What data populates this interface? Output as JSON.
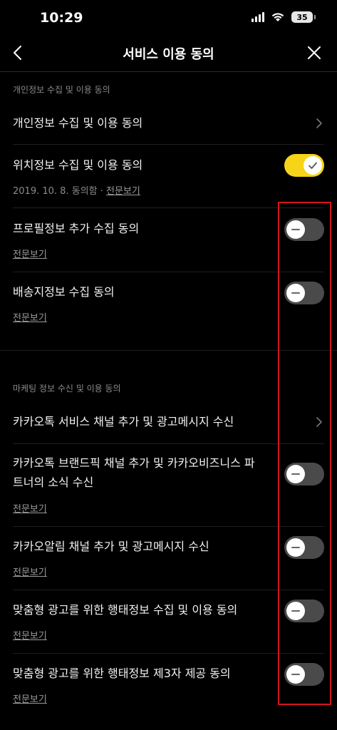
{
  "status_bar": {
    "time": "10:29",
    "battery": "35"
  },
  "header": {
    "title": "서비스 이용 동의"
  },
  "sections": [
    {
      "title": "개인정보 수집 및 이용 동의",
      "items": [
        {
          "title": "개인정보 수집 및 이용 동의",
          "control": "chevron"
        },
        {
          "title": "위치정보 수집 및 이용 동의",
          "date": "2019. 10. 8. 동의함",
          "separator": "·",
          "link": "전문보기",
          "control": "toggle",
          "state": "on"
        },
        {
          "title": "프로필정보 추가 수집 동의",
          "link": "전문보기",
          "control": "toggle",
          "state": "off"
        },
        {
          "title": "배송지정보 수집 동의",
          "link": "전문보기",
          "control": "toggle",
          "state": "off"
        }
      ]
    },
    {
      "title": "마케팅 정보 수신 및 이용 동의",
      "items": [
        {
          "title": "카카오톡 서비스 채널 추가 및 광고메시지 수신",
          "control": "chevron"
        },
        {
          "title_line1": "카카오톡 브랜드픽 채널 추가 및 카카오비즈니스 파",
          "title_line2": "트너의 소식 수신",
          "link": "전문보기",
          "control": "toggle",
          "state": "off"
        },
        {
          "title": "카카오알림 채널 추가 및 광고메시지 수신",
          "link": "전문보기",
          "control": "toggle",
          "state": "off"
        },
        {
          "title": "맞춤형 광고를 위한 행태정보 수집 및 이용 동의",
          "link": "전문보기",
          "control": "toggle",
          "state": "off"
        },
        {
          "title": "맞춤형 광고를 위한 행태정보 제3자 제공 동의",
          "link": "전문보기",
          "control": "toggle",
          "state": "off"
        }
      ]
    }
  ],
  "colors": {
    "toggle_on": "#f7d417",
    "toggle_off": "#4a4a4a",
    "highlight": "#d4151b",
    "background": "#000000"
  }
}
